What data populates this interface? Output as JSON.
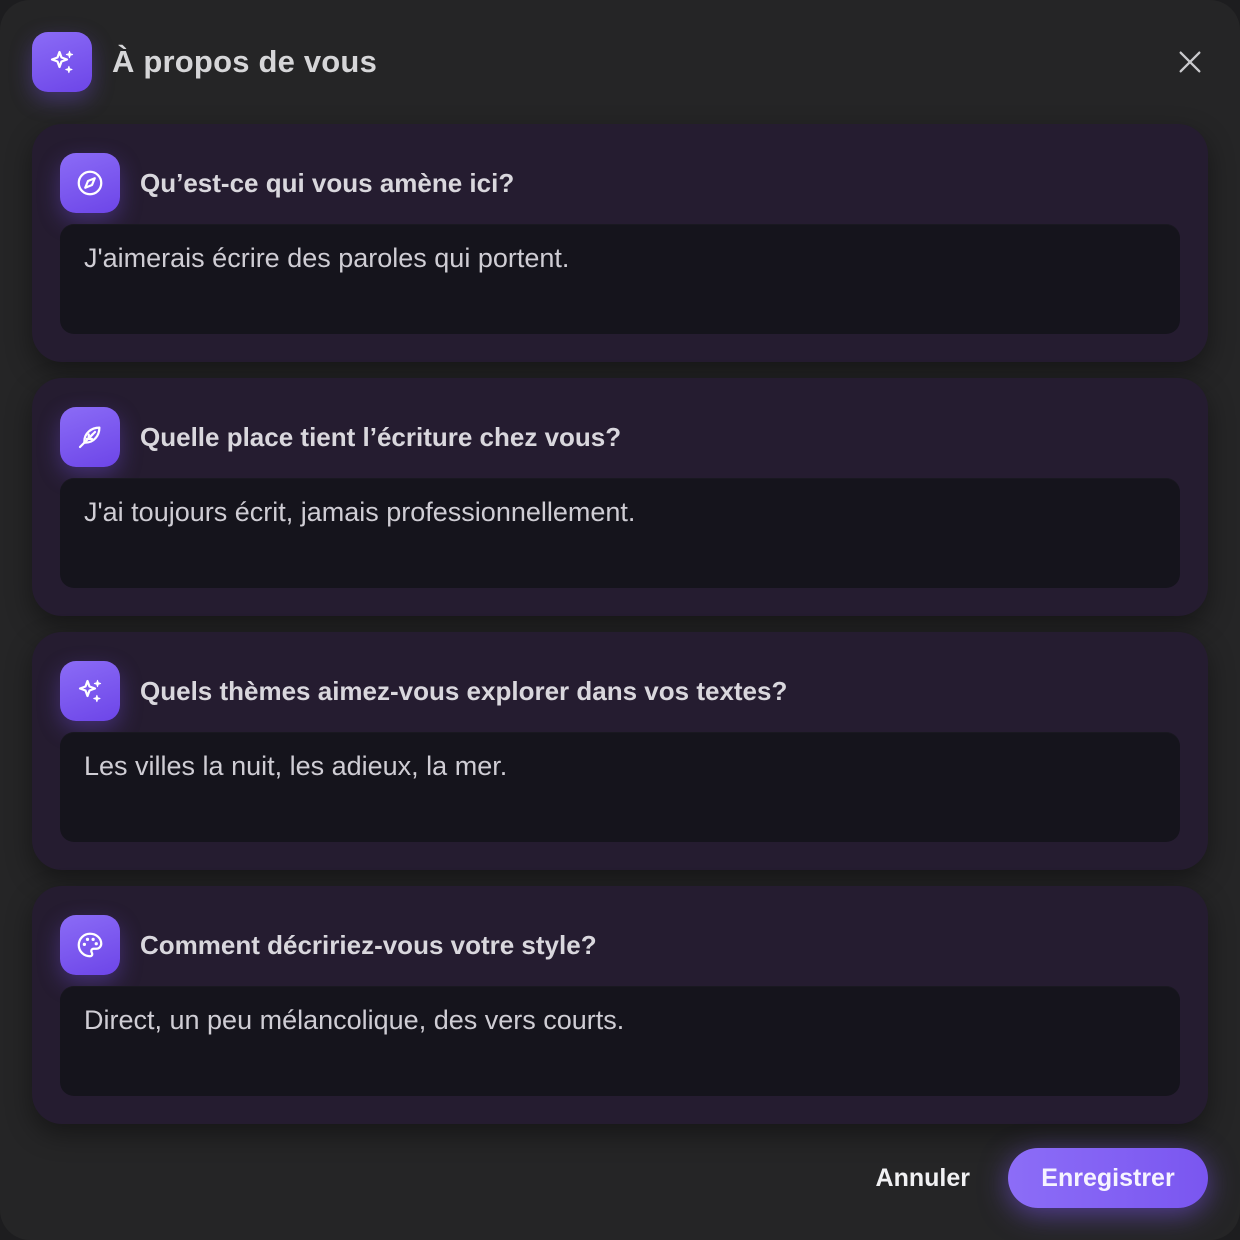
{
  "dialog": {
    "title": "À propos de vous",
    "title_icon": "sparkles-icon",
    "close_icon": "close-icon"
  },
  "questions": [
    {
      "icon": "compass-icon",
      "label": "Qu’est-ce qui vous amène ici?",
      "answer": "J'aimerais écrire des paroles qui portent."
    },
    {
      "icon": "feather-icon",
      "label": "Quelle place tient l’écriture chez vous?",
      "answer": "J'ai toujours écrit, jamais professionnellement."
    },
    {
      "icon": "sparkles-icon",
      "label": "Quels thèmes aimez-vous explorer dans vos textes?",
      "answer": "Les villes la nuit, les adieux, la mer."
    },
    {
      "icon": "palette-icon",
      "label": "Comment décririez-vous votre style?",
      "answer": "Direct, un peu mélancolique, des vers courts."
    }
  ],
  "footer": {
    "cancel_label": "Annuler",
    "save_label": "Enregistrer"
  },
  "colors": {
    "accent": "#7c5cf2",
    "background": "#252526",
    "card": "#251c30",
    "field": "#15141c"
  }
}
